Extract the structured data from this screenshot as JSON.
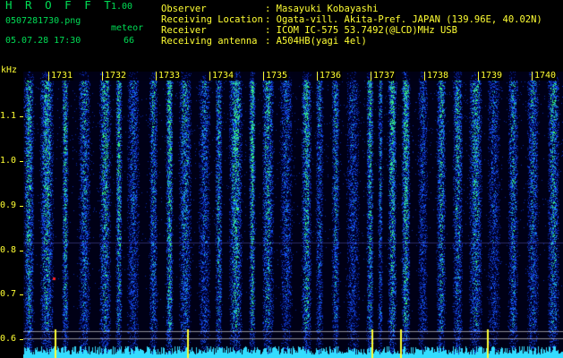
{
  "header": {
    "app_title": "H R O F F T",
    "app_version": "1.00",
    "filename": "0507281730.png",
    "meteor_label": "meteor",
    "datetime": "05.07.28 17:30",
    "meteor_count": "66"
  },
  "info": [
    {
      "label": "Observer",
      "value": ": Masayuki Kobayashi"
    },
    {
      "label": "Receiving Location",
      "value": ": Ogata-vill. Akita-Pref. JAPAN (139.96E, 40.02N)"
    },
    {
      "label": "Receiver",
      "value": ": ICOM IC-575 53.7492(@LCD)MHz USB"
    },
    {
      "label": "Receiving antenna",
      "value": ": A504HB(yagi 4el)"
    }
  ],
  "y_axis": {
    "unit": "kHz",
    "ticks": [
      "1.1",
      "1.0",
      "0.9",
      "0.8",
      "0.7",
      "0.6"
    ]
  },
  "time_axis": {
    "labels": [
      "1731",
      "1732",
      "1733",
      "1734",
      "1735",
      "1736",
      "1737",
      "1738",
      "1739",
      "1740"
    ]
  },
  "colors": {
    "background": "#000000",
    "header_green": "#00dd55",
    "header_yellow": "#ffff33",
    "spectrum_low": "#001a66",
    "spectrum_mid": "#1a55ff",
    "spectrum_high": "#33ff66",
    "meteor_echo": "#ff2222",
    "baseline": "#33ddff"
  }
}
